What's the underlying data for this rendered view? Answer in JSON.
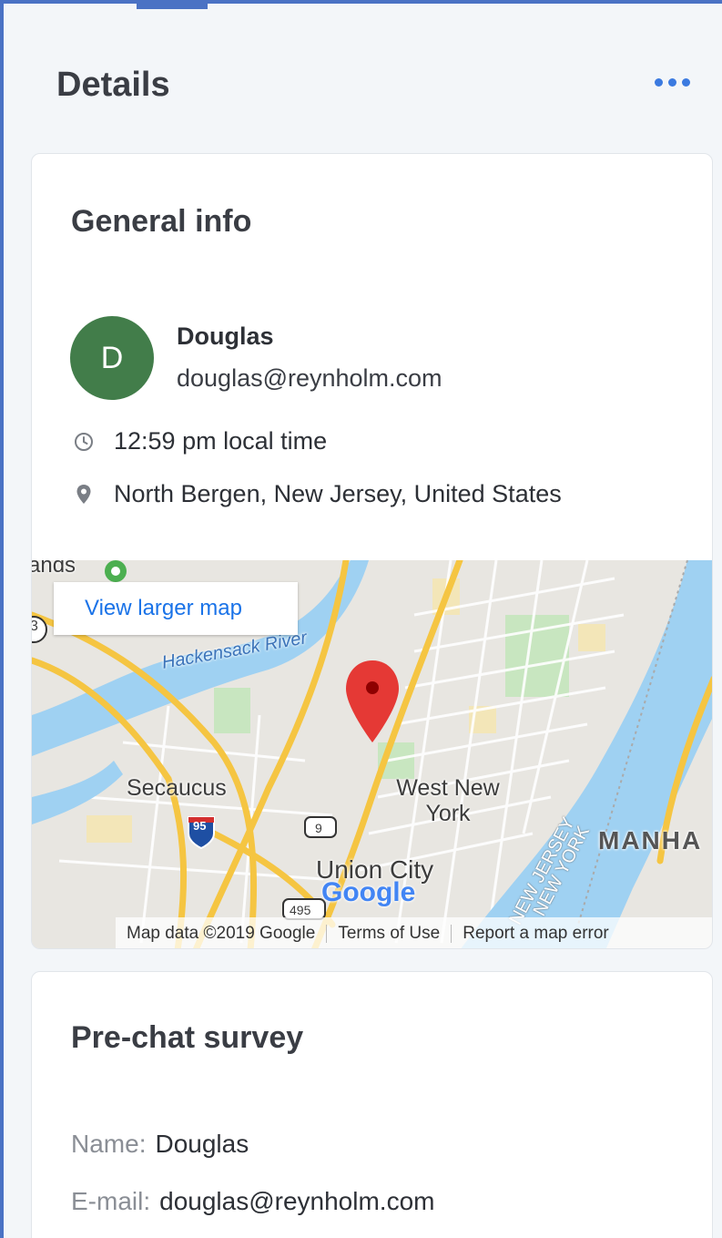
{
  "header": {
    "title": "Details",
    "more_icon": "more-horizontal-icon"
  },
  "general_info": {
    "title": "General info",
    "avatar_initial": "D",
    "avatar_color": "#427d4a",
    "name": "Douglas",
    "email": "douglas@reynholm.com",
    "local_time": "12:59 pm local time",
    "time_icon": "clock-icon",
    "location": "North Bergen, New Jersey, United States",
    "location_icon": "map-pin-icon"
  },
  "map": {
    "view_larger": "View larger map",
    "labels": {
      "islands": "ands",
      "river": "Hackensack River",
      "secaucus": "Secaucus",
      "west_new_york": "West New York",
      "union_city": "Union City",
      "manhattan": "MANHA",
      "new_jersey": "NEW JERSEY",
      "new_york": "NEW YORK",
      "route_9": "9",
      "route_95": "95",
      "route_495": "495",
      "brand": "Google",
      "side_marker": "3"
    },
    "footer": {
      "data": "Map data ©2019 Google",
      "terms": "Terms of Use",
      "report": "Report a map error"
    }
  },
  "survey": {
    "title": "Pre-chat survey",
    "name_label": "Name:",
    "name_value": "Douglas",
    "email_label": "E-mail:",
    "email_value": "douglas@reynholm.com"
  },
  "colors": {
    "accent": "#3b7ae0",
    "frame": "#4a72c4",
    "pin": "#e53935"
  }
}
